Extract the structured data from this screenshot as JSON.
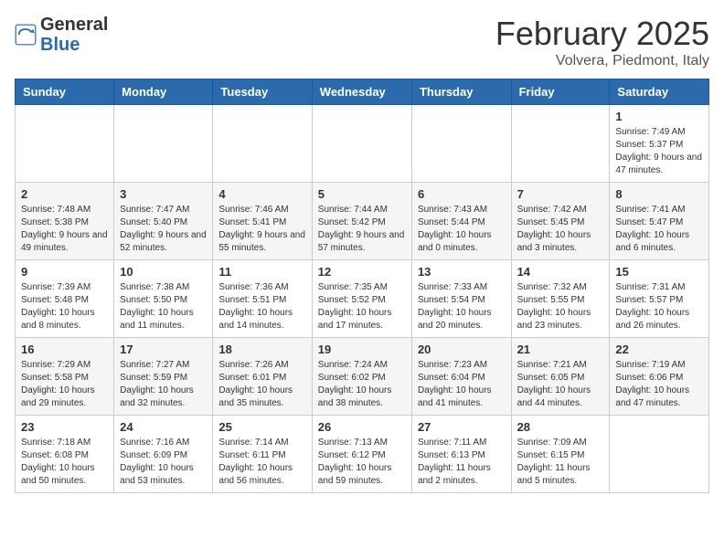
{
  "header": {
    "logo_general": "General",
    "logo_blue": "Blue",
    "month_title": "February 2025",
    "location": "Volvera, Piedmont, Italy"
  },
  "days_of_week": [
    "Sunday",
    "Monday",
    "Tuesday",
    "Wednesday",
    "Thursday",
    "Friday",
    "Saturday"
  ],
  "weeks": [
    [
      {
        "day": "",
        "info": ""
      },
      {
        "day": "",
        "info": ""
      },
      {
        "day": "",
        "info": ""
      },
      {
        "day": "",
        "info": ""
      },
      {
        "day": "",
        "info": ""
      },
      {
        "day": "",
        "info": ""
      },
      {
        "day": "1",
        "info": "Sunrise: 7:49 AM\nSunset: 5:37 PM\nDaylight: 9 hours and 47 minutes."
      }
    ],
    [
      {
        "day": "2",
        "info": "Sunrise: 7:48 AM\nSunset: 5:38 PM\nDaylight: 9 hours and 49 minutes."
      },
      {
        "day": "3",
        "info": "Sunrise: 7:47 AM\nSunset: 5:40 PM\nDaylight: 9 hours and 52 minutes."
      },
      {
        "day": "4",
        "info": "Sunrise: 7:46 AM\nSunset: 5:41 PM\nDaylight: 9 hours and 55 minutes."
      },
      {
        "day": "5",
        "info": "Sunrise: 7:44 AM\nSunset: 5:42 PM\nDaylight: 9 hours and 57 minutes."
      },
      {
        "day": "6",
        "info": "Sunrise: 7:43 AM\nSunset: 5:44 PM\nDaylight: 10 hours and 0 minutes."
      },
      {
        "day": "7",
        "info": "Sunrise: 7:42 AM\nSunset: 5:45 PM\nDaylight: 10 hours and 3 minutes."
      },
      {
        "day": "8",
        "info": "Sunrise: 7:41 AM\nSunset: 5:47 PM\nDaylight: 10 hours and 6 minutes."
      }
    ],
    [
      {
        "day": "9",
        "info": "Sunrise: 7:39 AM\nSunset: 5:48 PM\nDaylight: 10 hours and 8 minutes."
      },
      {
        "day": "10",
        "info": "Sunrise: 7:38 AM\nSunset: 5:50 PM\nDaylight: 10 hours and 11 minutes."
      },
      {
        "day": "11",
        "info": "Sunrise: 7:36 AM\nSunset: 5:51 PM\nDaylight: 10 hours and 14 minutes."
      },
      {
        "day": "12",
        "info": "Sunrise: 7:35 AM\nSunset: 5:52 PM\nDaylight: 10 hours and 17 minutes."
      },
      {
        "day": "13",
        "info": "Sunrise: 7:33 AM\nSunset: 5:54 PM\nDaylight: 10 hours and 20 minutes."
      },
      {
        "day": "14",
        "info": "Sunrise: 7:32 AM\nSunset: 5:55 PM\nDaylight: 10 hours and 23 minutes."
      },
      {
        "day": "15",
        "info": "Sunrise: 7:31 AM\nSunset: 5:57 PM\nDaylight: 10 hours and 26 minutes."
      }
    ],
    [
      {
        "day": "16",
        "info": "Sunrise: 7:29 AM\nSunset: 5:58 PM\nDaylight: 10 hours and 29 minutes."
      },
      {
        "day": "17",
        "info": "Sunrise: 7:27 AM\nSunset: 5:59 PM\nDaylight: 10 hours and 32 minutes."
      },
      {
        "day": "18",
        "info": "Sunrise: 7:26 AM\nSunset: 6:01 PM\nDaylight: 10 hours and 35 minutes."
      },
      {
        "day": "19",
        "info": "Sunrise: 7:24 AM\nSunset: 6:02 PM\nDaylight: 10 hours and 38 minutes."
      },
      {
        "day": "20",
        "info": "Sunrise: 7:23 AM\nSunset: 6:04 PM\nDaylight: 10 hours and 41 minutes."
      },
      {
        "day": "21",
        "info": "Sunrise: 7:21 AM\nSunset: 6:05 PM\nDaylight: 10 hours and 44 minutes."
      },
      {
        "day": "22",
        "info": "Sunrise: 7:19 AM\nSunset: 6:06 PM\nDaylight: 10 hours and 47 minutes."
      }
    ],
    [
      {
        "day": "23",
        "info": "Sunrise: 7:18 AM\nSunset: 6:08 PM\nDaylight: 10 hours and 50 minutes."
      },
      {
        "day": "24",
        "info": "Sunrise: 7:16 AM\nSunset: 6:09 PM\nDaylight: 10 hours and 53 minutes."
      },
      {
        "day": "25",
        "info": "Sunrise: 7:14 AM\nSunset: 6:11 PM\nDaylight: 10 hours and 56 minutes."
      },
      {
        "day": "26",
        "info": "Sunrise: 7:13 AM\nSunset: 6:12 PM\nDaylight: 10 hours and 59 minutes."
      },
      {
        "day": "27",
        "info": "Sunrise: 7:11 AM\nSunset: 6:13 PM\nDaylight: 11 hours and 2 minutes."
      },
      {
        "day": "28",
        "info": "Sunrise: 7:09 AM\nSunset: 6:15 PM\nDaylight: 11 hours and 5 minutes."
      },
      {
        "day": "",
        "info": ""
      }
    ]
  ]
}
